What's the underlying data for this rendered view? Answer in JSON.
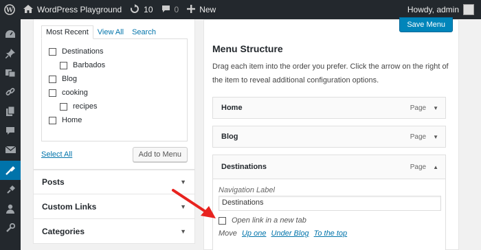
{
  "adminbar": {
    "site_name": "WordPress Playground",
    "updates_count": "10",
    "comments_count": "0",
    "new_label": "New",
    "greeting": "Howdy, admin"
  },
  "tabs": [
    {
      "label": "Most Recent"
    },
    {
      "label": "View All"
    },
    {
      "label": "Search"
    }
  ],
  "items": [
    {
      "label": "Destinations"
    },
    {
      "label": "Barbados"
    },
    {
      "label": "Blog"
    },
    {
      "label": "cooking"
    },
    {
      "label": "recipes"
    },
    {
      "label": "Home"
    }
  ],
  "select_all_label": "Select All",
  "add_to_menu_label": "Add to Menu",
  "accordion": [
    {
      "label": "Posts"
    },
    {
      "label": "Custom Links"
    },
    {
      "label": "Categories"
    }
  ],
  "save_menu_label": "Save Menu",
  "menu_structure": {
    "title": "Menu Structure",
    "description": "Drag each item into the order you prefer. Click the arrow on the right of the item to reveal additional configuration options."
  },
  "menu_items": [
    {
      "title": "Home",
      "type": "Page"
    },
    {
      "title": "Blog",
      "type": "Page"
    },
    {
      "title": "Destinations",
      "type": "Page"
    }
  ],
  "settings": {
    "nav_label_caption": "Navigation Label",
    "nav_label_value": "Destinations",
    "new_tab_label": "Open link in a new tab",
    "move_label": "Move",
    "move_up": "Up one",
    "move_under": "Under Blog",
    "move_top": "To the top"
  },
  "colors": {
    "adminbar": "#23282d",
    "active_menu": "#0073aa",
    "primary_button": "#0085ba",
    "annotation": "#e8231f"
  },
  "icons": [
    "wordpress-icon",
    "refresh-icon",
    "comment-icon",
    "plus-icon",
    "dashboard-icon",
    "pin-icon",
    "media-icon",
    "links-icon",
    "pages-icon",
    "comments-icon",
    "mail-icon",
    "appearance-icon",
    "plugins-icon",
    "users-icon",
    "tools-icon"
  ]
}
